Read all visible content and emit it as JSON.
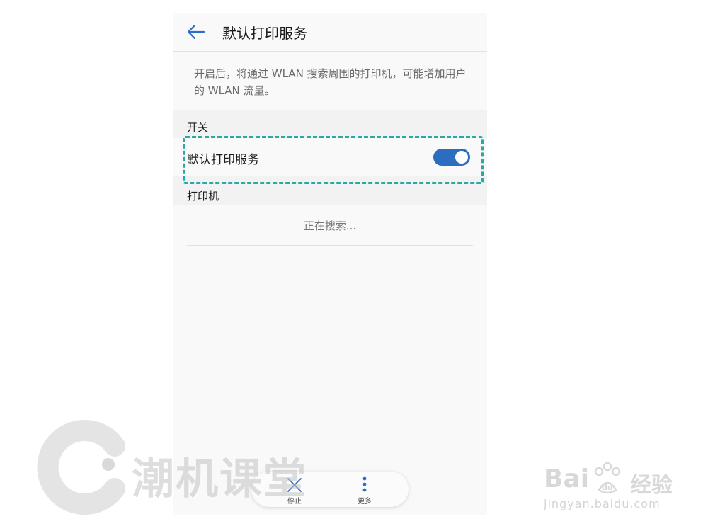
{
  "header": {
    "title": "默认打印服务",
    "back_icon": "arrow-left-icon"
  },
  "description": "开启后，将通过 WLAN 搜索周围的打印机，可能增加用户的 WLAN 流量。",
  "switch_section": {
    "label": "开关",
    "row_label": "默认打印服务",
    "toggle_on": true,
    "toggle_color": "#2c6dc2"
  },
  "printers_section": {
    "label": "打印机",
    "status": "正在搜索..."
  },
  "bottom_bar": {
    "stop_label": "停止",
    "stop_icon": "close-icon",
    "more_label": "更多",
    "more_icon": "more-vertical-icon"
  },
  "highlight_color": "#27aaa6",
  "watermarks": {
    "left_text": "潮机课堂",
    "baidu_name": "Bai",
    "baidu_suffix": "经验",
    "baidu_url": "jingyan.baidu.com"
  }
}
